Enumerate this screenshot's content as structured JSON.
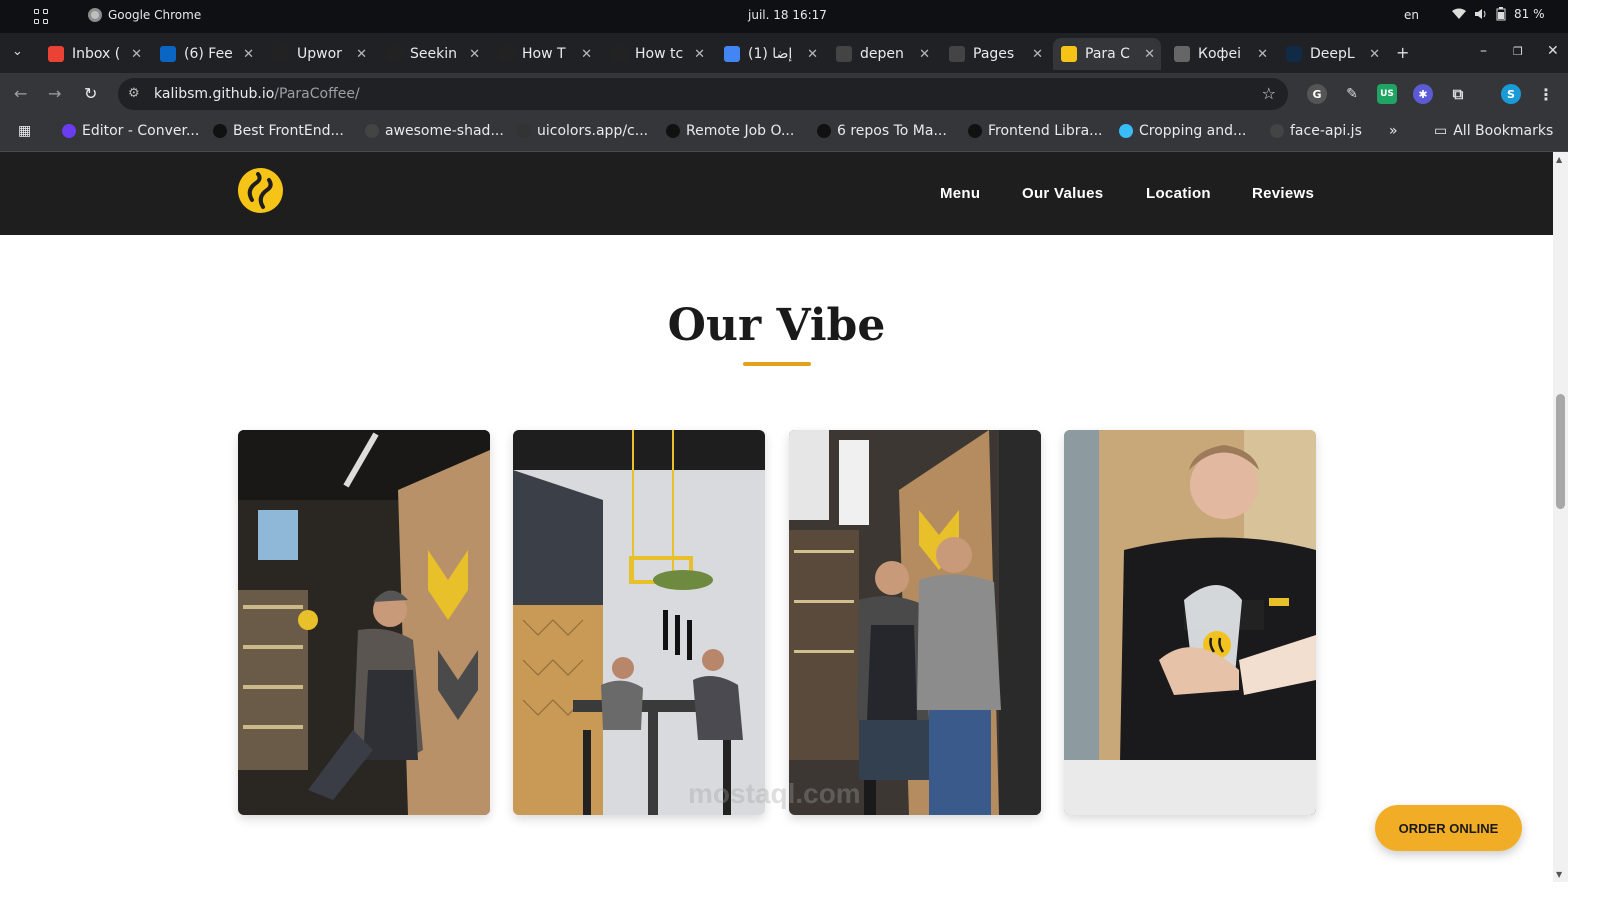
{
  "os_bar": {
    "app_name": "Google Chrome",
    "datetime": "juil. 18  16:17",
    "language": "en",
    "battery": "81 %"
  },
  "tabs": [
    {
      "title": "Inbox (",
      "icon": "gmail-icon",
      "color": "#ea4335"
    },
    {
      "title": "(6) Fee",
      "icon": "linkedin-icon",
      "color": "#0a66c2"
    },
    {
      "title": "Upwor",
      "icon": "upwork-icon",
      "color": "#222222"
    },
    {
      "title": "Seekin",
      "icon": "upwork-icon",
      "color": "#222222"
    },
    {
      "title": "How T",
      "icon": "upwork-icon",
      "color": "#222222"
    },
    {
      "title": "How tc",
      "icon": "upwork-icon",
      "color": "#222222"
    },
    {
      "title": "(1) إضا",
      "icon": "notification-icon",
      "color": "#4285f4"
    },
    {
      "title": "depen",
      "icon": "gear-icon",
      "color": "#444444"
    },
    {
      "title": "Pages",
      "icon": "github-icon",
      "color": "#444444"
    },
    {
      "title": "Para C",
      "icon": "paracoffee-icon",
      "color": "#f6c417"
    },
    {
      "title": "Кофеі",
      "icon": "globe-icon",
      "color": "#666666"
    },
    {
      "title": "DeepL",
      "icon": "deepl-icon",
      "color": "#0f2b46"
    }
  ],
  "address_bar": {
    "domain": "kalibsm.github.io",
    "path": "/ParaCoffee/"
  },
  "bookmarks": [
    {
      "label": "Editor - Conver...",
      "color": "#6b3df0"
    },
    {
      "label": "Best FrontEnd...",
      "color": "#111111"
    },
    {
      "label": "awesome-shad...",
      "color": "#444444"
    },
    {
      "label": "uicolors.app/c...",
      "color": "#333333"
    },
    {
      "label": "Remote Job O...",
      "color": "#111111"
    },
    {
      "label": "6 repos To Ma...",
      "color": "#111111"
    },
    {
      "label": "Frontend Libra...",
      "color": "#111111"
    },
    {
      "label": "Cropping and...",
      "color": "#38bdf8"
    },
    {
      "label": "face-api.js",
      "color": "#444444"
    }
  ],
  "bookmarks_overflow": "»",
  "all_bookmarks": "All Bookmarks",
  "site": {
    "nav": [
      "Menu",
      "Our Values",
      "Location",
      "Reviews"
    ],
    "section_title": "Our Vibe",
    "gallery": [
      {
        "name": "barista-juggling-photo"
      },
      {
        "name": "cafe-interior-photo"
      },
      {
        "name": "baristas-portrait-photo"
      },
      {
        "name": "barista-serving-drink-photo"
      }
    ],
    "order_button": "ORDER ONLINE",
    "watermark": "mostaql.com"
  },
  "colors": {
    "accent": "#e4a11b",
    "brand_yellow": "#f6c417",
    "nav_bg": "#1e1e1e",
    "order_button": "#f2ad26"
  }
}
